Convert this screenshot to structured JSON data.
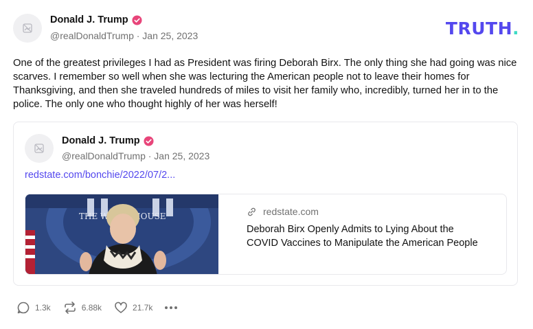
{
  "post": {
    "author_name": "Donald J. Trump",
    "handle_date": "@realDonaldTrump · Jan 25, 2023",
    "text": "One of the greatest privileges I had as President was firing Deborah Birx. The only thing she had going was nice scarves. I remember so well when she was lecturing the American people not to leave their homes for Thanksgiving, and then she traveled hundreds of miles to visit her family who, incredibly, turned her in to the police. The only one who thought highly of her was herself!"
  },
  "logo": {
    "main": "TRUTH",
    "dot": "."
  },
  "quote": {
    "author_name": "Donald J. Trump",
    "handle_date": "@realDonaldTrump · Jan 25, 2023",
    "link_text": "redstate.com/bonchie/2022/07/2...",
    "preview": {
      "domain": "redstate.com",
      "headline": "Deborah Birx Openly Admits to Lying About the COVID Vaccines to Manipulate the American People",
      "image_sign_text": "THE WHITE HOUSE"
    }
  },
  "actions": {
    "replies": "1.3k",
    "retruths": "6.88k",
    "likes": "21.7k"
  },
  "colors": {
    "brand": "#5448ee",
    "brand_dot": "#3ddbc5",
    "verified": "#e8457a",
    "muted": "#707070"
  }
}
